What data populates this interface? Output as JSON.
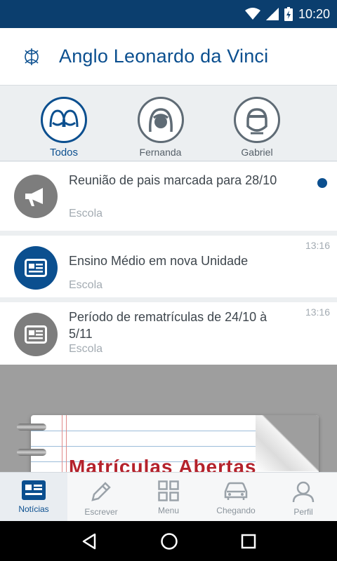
{
  "status_bar": {
    "time": "10:20",
    "background": "#0b3e6e"
  },
  "app": {
    "title": "Anglo Leonardo da Vinci",
    "brand_color": "#0b4f8f"
  },
  "filters": [
    {
      "label": "Todos",
      "icon": "group-icon",
      "active": true
    },
    {
      "label": "Fernanda",
      "icon": "girl-avatar-icon",
      "active": false
    },
    {
      "label": "Gabriel",
      "icon": "boy-avatar-icon",
      "active": false
    }
  ],
  "feed": [
    {
      "title": "Reunião de pais marcada para 28/10",
      "source": "Escola",
      "time": "",
      "unread": true,
      "icon": "megaphone-icon",
      "icon_bg": "#7d7d7d"
    },
    {
      "title": "Ensino Médio em nova Unidade",
      "source": "Escola",
      "time": "13:16",
      "unread": false,
      "icon": "newspaper-icon",
      "icon_bg": "#0b4f8f"
    },
    {
      "title": "Período de rematrículas de 24/10 à 5/11",
      "source": "Escola",
      "time": "13:16",
      "unread": false,
      "icon": "newspaper-icon",
      "icon_bg": "#7d7d7d"
    }
  ],
  "banner": {
    "text": "Matrículas Abertas"
  },
  "bottom_nav": [
    {
      "label": "Notícias",
      "icon": "news-icon",
      "active": true
    },
    {
      "label": "Escrever",
      "icon": "pencil-icon",
      "active": false
    },
    {
      "label": "Menu",
      "icon": "grid-icon",
      "active": false
    },
    {
      "label": "Chegando",
      "icon": "car-icon",
      "active": false
    },
    {
      "label": "Perfil",
      "icon": "person-icon",
      "active": false
    }
  ]
}
